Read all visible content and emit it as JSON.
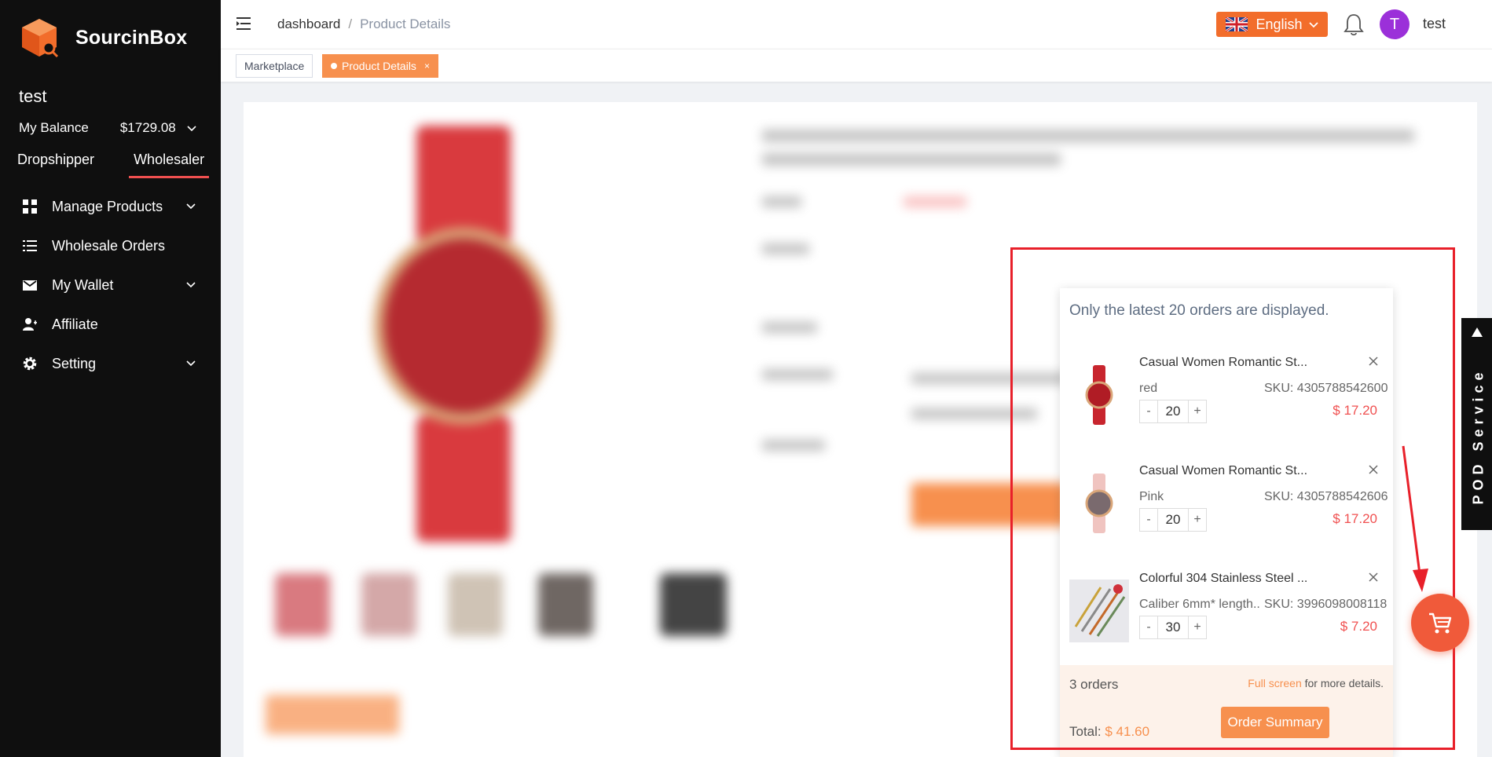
{
  "brand": {
    "name": "SourcinBox"
  },
  "sidebar": {
    "user_name": "test",
    "balance_label": "My Balance",
    "balance_value": "$1729.08",
    "roles": [
      "Dropshipper",
      "Wholesaler"
    ],
    "active_role": "Wholesaler",
    "items": [
      {
        "label": "Manage Products",
        "icon": "grid-icon",
        "has_children": true
      },
      {
        "label": "Wholesale Orders",
        "icon": "list-icon",
        "has_children": false
      },
      {
        "label": "My Wallet",
        "icon": "envelope-icon",
        "has_children": true
      },
      {
        "label": "Affiliate",
        "icon": "user-add-icon",
        "has_children": false
      },
      {
        "label": "Setting",
        "icon": "gear-icon",
        "has_children": true
      }
    ]
  },
  "header": {
    "breadcrumb": [
      "dashboard",
      "Product Details"
    ],
    "language": "English",
    "user_initial": "T",
    "user_name": "test"
  },
  "tags": [
    {
      "label": "Marketplace",
      "active": false
    },
    {
      "label": "Product Details",
      "active": true,
      "close": "×"
    }
  ],
  "cart": {
    "note": "Only the latest 20 orders are displayed.",
    "items": [
      {
        "name": "Casual Women Romantic St...",
        "variant": "red",
        "sku": "SKU: 4305788542600",
        "qty": "20",
        "price": "$ 17.20"
      },
      {
        "name": "Casual Women Romantic St...",
        "variant": "Pink",
        "sku": "SKU: 4305788542606",
        "qty": "20",
        "price": "$ 17.20"
      },
      {
        "name": "Colorful 304 Stainless Steel ...",
        "variant": "Caliber 6mm* length...",
        "sku": "SKU: 3996098008118",
        "qty": "30",
        "price": "$ 7.20"
      }
    ],
    "stepper_minus": "-",
    "stepper_plus": "+",
    "orders_count": "3 orders",
    "fullscreen_link": "Full screen",
    "fullscreen_rest": " for more details.",
    "total_label": "Total: ",
    "total_value": "$ 41.60",
    "summary_button": "Order Summary"
  },
  "pod": {
    "label": "POD Service"
  },
  "colors": {
    "accent": "#f7904e",
    "brand_orange": "#f26d2b",
    "price_red": "#f05050",
    "sidebar_bg": "#0f0f0f"
  }
}
